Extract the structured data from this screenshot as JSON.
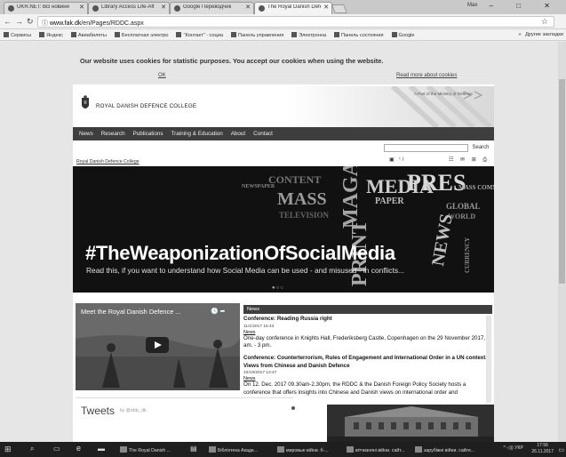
{
  "browser": {
    "tabs": [
      {
        "label": "UKR.NET: Всі новини Ук"
      },
      {
        "label": "Library Access Life-After"
      },
      {
        "label": "Google Переводчик"
      },
      {
        "label": "The Royal Danish Defen"
      }
    ],
    "user": "Max",
    "window_controls": "– □ ✕",
    "url_host": "www.fak.dk",
    "url_path": "/en/Pages/RDDC.aspx",
    "bookmarks": [
      "Сервисы",
      "Яндекс",
      "Авиабилеты",
      "Бесплатная электро",
      "\"Контакт\" - социа",
      "Панель управления",
      "Электронна",
      "Панель состояния",
      "Google"
    ],
    "bookmarks_more": "»",
    "bookmarks_other": "Другие закладки"
  },
  "cookie": {
    "text": "Our website uses cookies for statistic purposes. You accept our cookies when using the website.",
    "ok": "OK",
    "read_more": "Read more about cookies"
  },
  "site": {
    "name": "ROYAL DANISH DEFENCE COLLEGE",
    "ministry": "A Part of the Ministry of Defence",
    "nav": [
      "News",
      "Research",
      "Publications",
      "Training & Education",
      "About",
      "Contact"
    ],
    "search_label": "Search",
    "breadcrumb": "Royal Danish Defence College",
    "tool_icons": "▣ ᵗ/",
    "tool_icons2": "☷ ✉ ⊞ ⎙",
    "hero_title": "#TheWeaponizationOfSocialMedia",
    "hero_sub": "Read this, if you want to understand how Social Media can be used - and misused - in conflicts...",
    "hero_dots": "●○○",
    "video_title": "Meet the Royal Danish Defence ...",
    "video_controls": "🕓 ➦",
    "news_header": "News",
    "news": [
      {
        "title": "Conference: Reading Russia right",
        "date": "11/1/2017 15:43",
        "label": "News",
        "text": "One-day conference in Knights Hall, Frederiksberg Castle, Copenhagen on the 29 November 2017, 9 am. - 3 pm."
      },
      {
        "title": "Conference: Counterterrorism, Rules of Engagement and International Order in a UN context. Views from Chinese and Danish Defence",
        "date": "10/19/2017 13:47",
        "label": "News",
        "text": "On 12. Dec. 2017 09.30am-2.30pm, the RDDC & the Danish Foreign Policy Society hosts a conference that offers insights into Chinese and Danish views on international order and"
      }
    ],
    "tweets_title": "Tweets",
    "tweets_by": "by @rddc_dk"
  },
  "taskbar": {
    "items": [
      "The Royal Danish ...",
      "Бібліотека Акаде...",
      "мировые війни. б-...",
      "вітчизняні війни. сайт...",
      "зарубіжні війни. сайте..."
    ],
    "tray": "^ ◁)) УКР",
    "time": "17:56",
    "date": "26.11.2017"
  }
}
